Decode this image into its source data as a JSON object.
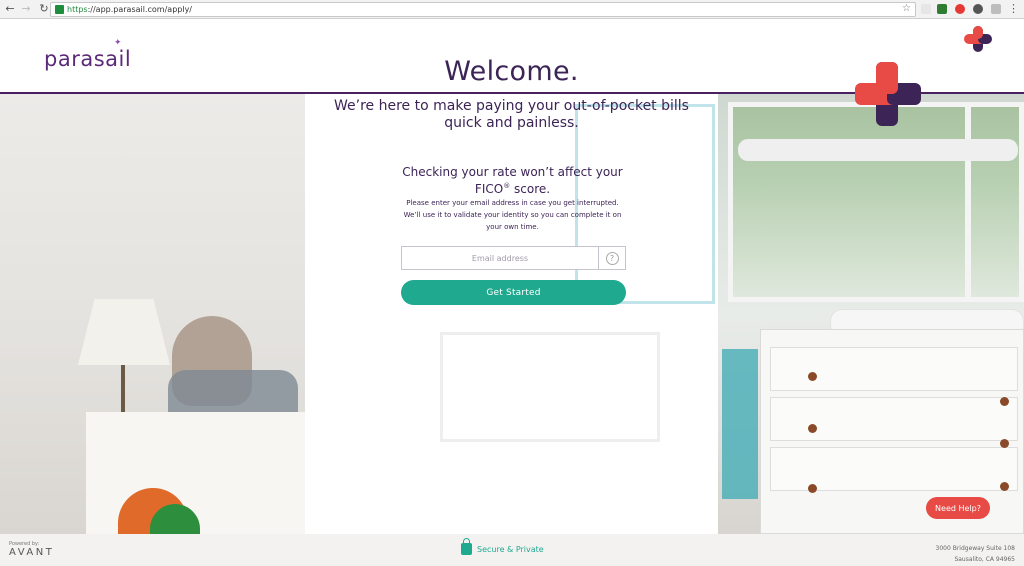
{
  "browser": {
    "url_https": "https",
    "url_rest": "://app.parasail.com/apply/",
    "icons": [
      "back-icon",
      "forward-icon",
      "reload-icon",
      "lock-icon",
      "star-icon",
      "menu-icon"
    ]
  },
  "header": {
    "logo_text": "parasail",
    "logo_spark": "✦",
    "brand_colors": {
      "purple": "#3d2457",
      "red": "#e84a45",
      "teal": "#1fa98f"
    }
  },
  "hero": {
    "title": "Welcome.",
    "tagline": "We’re here to make paying your out-of-pocket bills quick and painless.",
    "rate_line_before": "Checking your rate won’t affect your FICO",
    "rate_sup": "®",
    "rate_line_after": " score.",
    "fineprint": "Please enter your email address in case you get interrupted. We’ll use it to validate your identity so you can complete it on your own time.",
    "email_placeholder": "Email address",
    "help_symbol": "?",
    "cta_label": "Get Started"
  },
  "need_help_label": "Need Help?",
  "footer": {
    "powered_by": "Powered by:",
    "partner": "AVANT",
    "secure_label": "Secure & Private",
    "address_line1": "3000 Bridgeway Suite 108",
    "address_line2": "Sausalito, CA 94965"
  }
}
